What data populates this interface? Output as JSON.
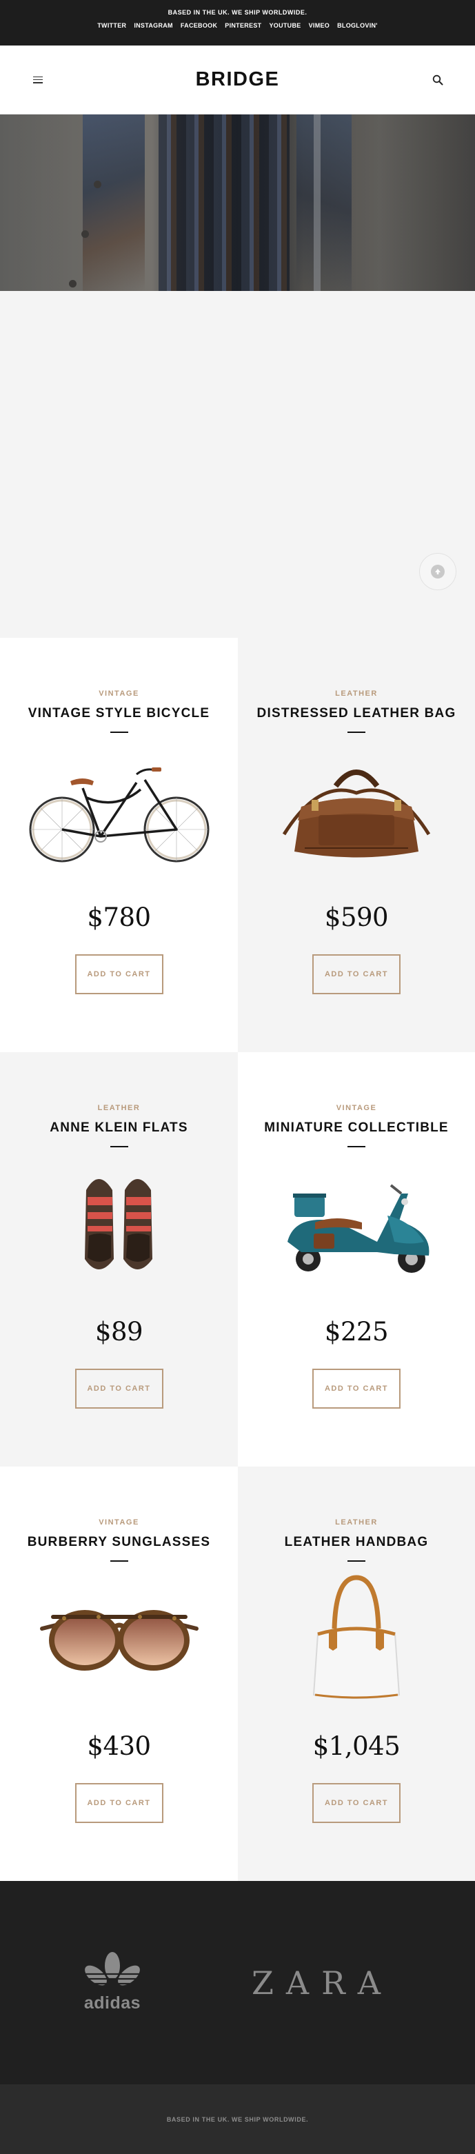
{
  "topbar": {
    "tagline": "BASED IN THE UK. WE SHIP WORLDWIDE.",
    "social_links": [
      "TWITTER",
      "INSTAGRAM",
      "FACEBOOK",
      "PINTEREST",
      "YOUTUBE",
      "VIMEO",
      "BLOGLOVIN'"
    ]
  },
  "header": {
    "logo": "BRIDGE",
    "menu_icon": "hamburger-menu-icon",
    "search_icon": "search-icon"
  },
  "back_to_top": {
    "icon": "arrow-up-icon"
  },
  "products": [
    {
      "category": "VINTAGE",
      "title": "VINTAGE STYLE BICYCLE",
      "price": "$780",
      "cta": "ADD TO CART",
      "image": "bicycle"
    },
    {
      "category": "LEATHER",
      "title": "DISTRESSED LEATHER BAG",
      "price": "$590",
      "cta": "ADD TO CART",
      "image": "leather-bag"
    },
    {
      "category": "LEATHER",
      "title": "ANNE KLEIN FLATS",
      "price": "$89",
      "cta": "ADD TO CART",
      "image": "flats"
    },
    {
      "category": "VINTAGE",
      "title": "MINIATURE COLLECTIBLE",
      "price": "$225",
      "cta": "ADD TO CART",
      "image": "scooter"
    },
    {
      "category": "VINTAGE",
      "title": "BURBERRY SUNGLASSES",
      "price": "$430",
      "cta": "ADD TO CART",
      "image": "sunglasses"
    },
    {
      "category": "LEATHER",
      "title": "LEATHER HANDBAG",
      "price": "$1,045",
      "cta": "ADD TO CART",
      "image": "handbag"
    }
  ],
  "brands": {
    "adidas": "adidas",
    "zara": "ZARA"
  },
  "footer": {
    "text": "BASED IN THE UK. WE SHIP WORLDWIDE."
  },
  "colors": {
    "accent": "#b89a7c",
    "dark": "#1d1d1d",
    "light_bg": "#f4f4f4"
  }
}
